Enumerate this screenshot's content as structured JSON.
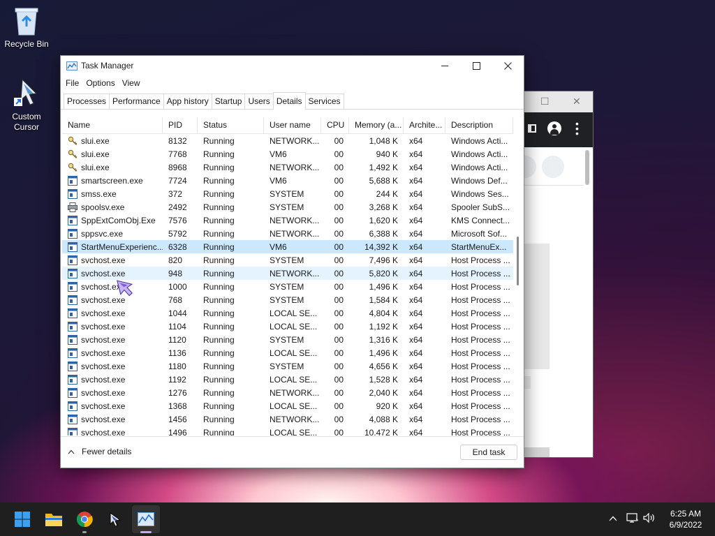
{
  "desktop": {
    "icons": [
      {
        "label": "Recycle Bin",
        "icon": "recycle-bin-icon"
      },
      {
        "label": "Custom\nCursor",
        "icon": "custom-cursor-icon"
      }
    ]
  },
  "window": {
    "title": "Task Manager",
    "menu": [
      "File",
      "Options",
      "View"
    ],
    "tabs": [
      "Processes",
      "Performance",
      "App history",
      "Startup",
      "Users",
      "Details",
      "Services"
    ],
    "active_tab": "Details",
    "columns": [
      "Name",
      "PID",
      "Status",
      "User name",
      "CPU",
      "Memory (a...",
      "Archite...",
      "Description"
    ],
    "rows": [
      {
        "name": "slui.exe",
        "icon": "key-icon",
        "pid": "8132",
        "status": "Running",
        "user": "NETWORK...",
        "cpu": "00",
        "mem": "1,048 K",
        "arch": "x64",
        "desc": "Windows Acti..."
      },
      {
        "name": "slui.exe",
        "icon": "key-icon",
        "pid": "7768",
        "status": "Running",
        "user": "VM6",
        "cpu": "00",
        "mem": "940 K",
        "arch": "x64",
        "desc": "Windows Acti..."
      },
      {
        "name": "slui.exe",
        "icon": "key-icon",
        "pid": "8968",
        "status": "Running",
        "user": "NETWORK...",
        "cpu": "00",
        "mem": "1,492 K",
        "arch": "x64",
        "desc": "Windows Acti..."
      },
      {
        "name": "smartscreen.exe",
        "icon": "app-window-icon",
        "pid": "7724",
        "status": "Running",
        "user": "VM6",
        "cpu": "00",
        "mem": "5,688 K",
        "arch": "x64",
        "desc": "Windows Def..."
      },
      {
        "name": "smss.exe",
        "icon": "app-window-icon",
        "pid": "372",
        "status": "Running",
        "user": "SYSTEM",
        "cpu": "00",
        "mem": "244 K",
        "arch": "x64",
        "desc": "Windows Ses..."
      },
      {
        "name": "spoolsv.exe",
        "icon": "printer-icon",
        "pid": "2492",
        "status": "Running",
        "user": "SYSTEM",
        "cpu": "00",
        "mem": "3,268 K",
        "arch": "x64",
        "desc": "Spooler SubS..."
      },
      {
        "name": "SppExtComObj.Exe",
        "icon": "app-window-icon",
        "pid": "7576",
        "status": "Running",
        "user": "NETWORK...",
        "cpu": "00",
        "mem": "1,620 K",
        "arch": "x64",
        "desc": "KMS Connect..."
      },
      {
        "name": "sppsvc.exe",
        "icon": "app-window-icon",
        "pid": "5792",
        "status": "Running",
        "user": "NETWORK...",
        "cpu": "00",
        "mem": "6,388 K",
        "arch": "x64",
        "desc": "Microsoft Sof..."
      },
      {
        "name": "StartMenuExperienc...",
        "icon": "app-window-icon",
        "pid": "6328",
        "status": "Running",
        "user": "VM6",
        "cpu": "00",
        "mem": "14,392 K",
        "arch": "x64",
        "desc": "StartMenuEx..."
      },
      {
        "name": "svchost.exe",
        "icon": "app-window-icon",
        "pid": "820",
        "status": "Running",
        "user": "SYSTEM",
        "cpu": "00",
        "mem": "7,496 K",
        "arch": "x64",
        "desc": "Host Process ..."
      },
      {
        "name": "svchost.exe",
        "icon": "app-window-icon",
        "pid": "948",
        "status": "Running",
        "user": "NETWORK...",
        "cpu": "00",
        "mem": "5,820 K",
        "arch": "x64",
        "desc": "Host Process ..."
      },
      {
        "name": "svchost.exe",
        "icon": "app-window-icon",
        "pid": "1000",
        "status": "Running",
        "user": "SYSTEM",
        "cpu": "00",
        "mem": "1,496 K",
        "arch": "x64",
        "desc": "Host Process ..."
      },
      {
        "name": "svchost.exe",
        "icon": "app-window-icon",
        "pid": "768",
        "status": "Running",
        "user": "SYSTEM",
        "cpu": "00",
        "mem": "1,584 K",
        "arch": "x64",
        "desc": "Host Process ..."
      },
      {
        "name": "svchost.exe",
        "icon": "app-window-icon",
        "pid": "1044",
        "status": "Running",
        "user": "LOCAL SE...",
        "cpu": "00",
        "mem": "4,804 K",
        "arch": "x64",
        "desc": "Host Process ..."
      },
      {
        "name": "svchost.exe",
        "icon": "app-window-icon",
        "pid": "1104",
        "status": "Running",
        "user": "LOCAL SE...",
        "cpu": "00",
        "mem": "1,192 K",
        "arch": "x64",
        "desc": "Host Process ..."
      },
      {
        "name": "svchost.exe",
        "icon": "app-window-icon",
        "pid": "1120",
        "status": "Running",
        "user": "SYSTEM",
        "cpu": "00",
        "mem": "1,316 K",
        "arch": "x64",
        "desc": "Host Process ..."
      },
      {
        "name": "svchost.exe",
        "icon": "app-window-icon",
        "pid": "1136",
        "status": "Running",
        "user": "LOCAL SE...",
        "cpu": "00",
        "mem": "1,496 K",
        "arch": "x64",
        "desc": "Host Process ..."
      },
      {
        "name": "svchost.exe",
        "icon": "app-window-icon",
        "pid": "1180",
        "status": "Running",
        "user": "SYSTEM",
        "cpu": "00",
        "mem": "4,656 K",
        "arch": "x64",
        "desc": "Host Process ..."
      },
      {
        "name": "svchost.exe",
        "icon": "app-window-icon",
        "pid": "1192",
        "status": "Running",
        "user": "LOCAL SE...",
        "cpu": "00",
        "mem": "1,528 K",
        "arch": "x64",
        "desc": "Host Process ..."
      },
      {
        "name": "svchost.exe",
        "icon": "app-window-icon",
        "pid": "1276",
        "status": "Running",
        "user": "NETWORK...",
        "cpu": "00",
        "mem": "2,040 K",
        "arch": "x64",
        "desc": "Host Process ..."
      },
      {
        "name": "svchost.exe",
        "icon": "app-window-icon",
        "pid": "1368",
        "status": "Running",
        "user": "LOCAL SE...",
        "cpu": "00",
        "mem": "920 K",
        "arch": "x64",
        "desc": "Host Process ..."
      },
      {
        "name": "svchost.exe",
        "icon": "app-window-icon",
        "pid": "1456",
        "status": "Running",
        "user": "NETWORK...",
        "cpu": "00",
        "mem": "4,088 K",
        "arch": "x64",
        "desc": "Host Process ..."
      },
      {
        "name": "svchost.exe",
        "icon": "app-window-icon",
        "pid": "1496",
        "status": "Running",
        "user": "LOCAL SE...",
        "cpu": "00",
        "mem": "10,472 K",
        "arch": "x64",
        "desc": "Host Process ..."
      }
    ],
    "selected_row": 8,
    "hover_row": 10,
    "footer": {
      "fewer_details": "Fewer details",
      "end_task": "End task"
    }
  },
  "taskbar": {
    "apps": [
      "windows-start-icon",
      "file-explorer-icon",
      "chrome-icon",
      "custom-cursor-icon",
      "task-manager-icon"
    ],
    "clock": {
      "time": "6:25 AM",
      "date": "6/9/2022"
    }
  },
  "colors": {
    "selection": "#cce8ff",
    "hover": "#e5f3ff",
    "taskbar": "#1f1f1f",
    "accent": "#0078d4"
  }
}
